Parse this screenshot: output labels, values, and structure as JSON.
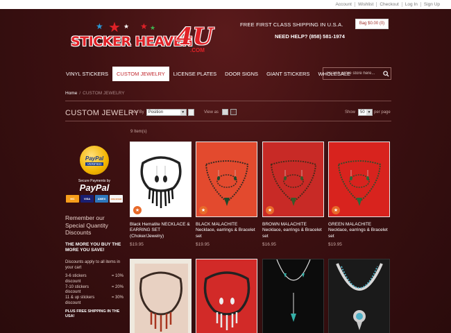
{
  "topbar": {
    "links": [
      "Account",
      "Wishlist",
      "Checkout",
      "Log In",
      "Sign Up"
    ]
  },
  "logo": {
    "text": "STICKER HEAVEN",
    "suffix": "4U",
    "domain": ".COM"
  },
  "header": {
    "shipping": "FREE FIRST CLASS SHIPPING IN U.S.A.",
    "help": "NEED HELP? (858) 581-1974",
    "bag": "Bag $0.00 (0)"
  },
  "nav": {
    "items": [
      "VINYL STICKERS",
      "CUSTOM JEWELRY",
      "LICENSE PLATES",
      "DOOR SIGNS",
      "GIANT STICKERS",
      "WHOLESALE"
    ],
    "active_index": 1
  },
  "search": {
    "placeholder": "Search entire store here..."
  },
  "breadcrumb": {
    "home": "Home",
    "separator": "/",
    "current": "CUSTOM JEWELRY"
  },
  "toolbar": {
    "sort_label": "Sort By",
    "sort_value": "Position",
    "view_label": "View as",
    "show_label": "Show",
    "show_value": "50",
    "per_page": "per page"
  },
  "page_title": "CUSTOM JEWELRY",
  "items_count": "9 Item(s)",
  "sidebar": {
    "seal_brand": "PayPal",
    "seal_status": "VERIFIED",
    "secure_text": "Secure Payments by",
    "paypal": "PayPal",
    "cards": [
      "MC",
      "VISA",
      "AMEX",
      "DISCOVER"
    ],
    "heading": "Remember our Special Quantity Discounts",
    "bold": "THE MORE YOU BUY THE MORE YOU SAVE!",
    "small": "Discounts apply to all items in your cart",
    "tiers": [
      {
        "qty": "3-6 stickers",
        "disc": "= 10%",
        "suffix": "discount"
      },
      {
        "qty": "7-10 stickers",
        "disc": "= 20%",
        "suffix": "discount"
      },
      {
        "qty": "11 & up stickers",
        "disc": "= 30%",
        "suffix": "discount"
      }
    ],
    "free": "PLUS FREE SHIPPING IN THE USA!"
  },
  "products": [
    {
      "name": "Black Hematite NECKLACE & EARRING SET (Choker/Jewelry)",
      "price": "$19.95",
      "bg": "#ffffff"
    },
    {
      "name": "BLACK MALACHITE Necklace, earrings & Bracelet set",
      "price": "$19.95",
      "bg": "#e34a2e"
    },
    {
      "name": "BROWN MALACHITE Necklace, earrings & Bracelet set",
      "price": "$16.95",
      "bg": "#c82a26"
    },
    {
      "name": "GREEN MALACHITE Necklace, earrings & Bracelet set",
      "price": "$19.95",
      "bg": "#d8231e"
    },
    {
      "name": "",
      "price": "",
      "bg": "#efe9de"
    },
    {
      "name": "",
      "price": "",
      "bg": "#d22a28"
    },
    {
      "name": "",
      "price": "",
      "bg": "#0c0c0c"
    },
    {
      "name": "",
      "price": "",
      "bg": "#1a1a1a"
    }
  ],
  "colors": {
    "accent": "#c1272d",
    "badge": "#e86a2a"
  }
}
